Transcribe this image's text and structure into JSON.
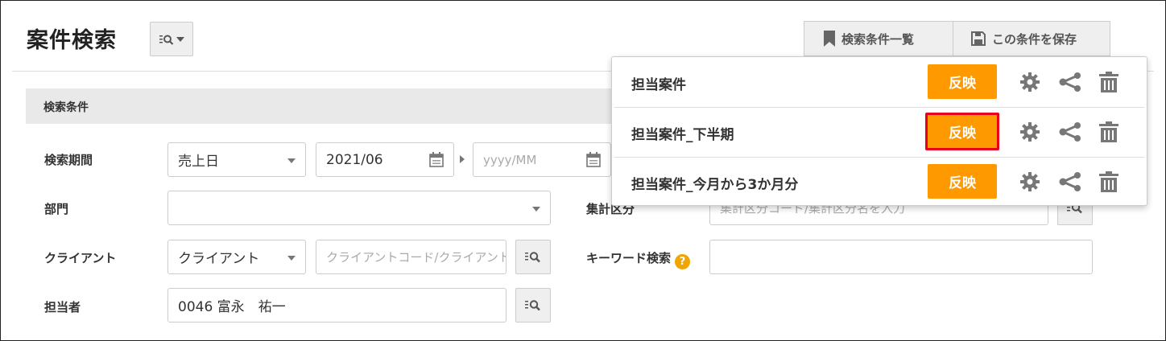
{
  "page": {
    "title": "案件検索"
  },
  "header": {
    "saved_list_label": "検索条件一覧",
    "save_label": "この条件を保存"
  },
  "section": {
    "title": "検索条件"
  },
  "form": {
    "period": {
      "label": "検索期間",
      "type_value": "売上日",
      "from_value": "2021/06",
      "to_placeholder": "yyyy/MM"
    },
    "department": {
      "label": "部門",
      "value": ""
    },
    "aggregation": {
      "label": "集計区分",
      "placeholder": "集計区分コード/集計区分名を入力"
    },
    "client": {
      "label": "クライアント",
      "type_value": "クライアント",
      "placeholder": "クライアントコード/クライアント名を入力"
    },
    "keyword": {
      "label": "キーワード検索",
      "help": "?",
      "value": ""
    },
    "assignee": {
      "label": "担当者",
      "value": "0046 富永　祐一"
    }
  },
  "saved_conditions": [
    {
      "name": "担当案件",
      "apply_label": "反映"
    },
    {
      "name": "担当案件_下半期",
      "apply_label": "反映"
    },
    {
      "name": "担当案件_今月から3か月分",
      "apply_label": "反映"
    }
  ],
  "colors": {
    "accent": "#ff9900",
    "highlight": "#e8001c",
    "help": "#f0a500"
  }
}
